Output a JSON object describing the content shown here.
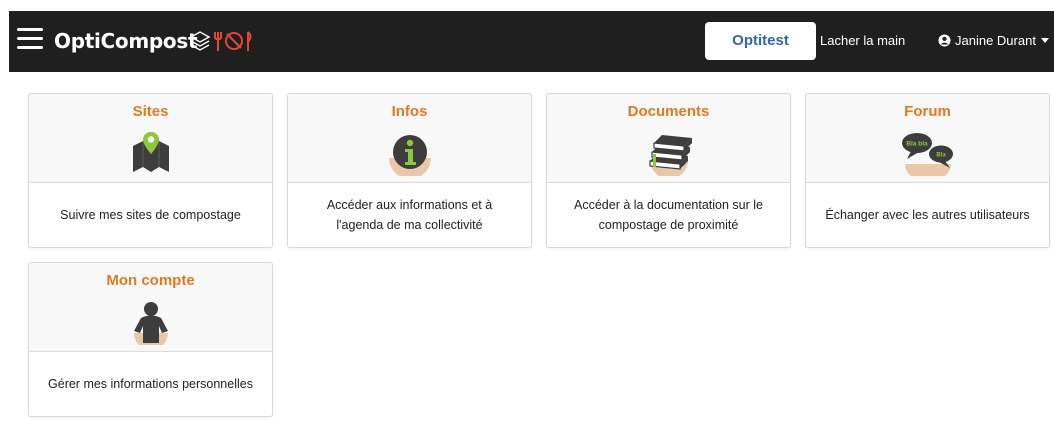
{
  "header": {
    "brand": "OptiCompost",
    "optitest_label": "Optitest",
    "lacher_label": "Lacher la main",
    "user_name": "Janine Durant"
  },
  "colors": {
    "navbar": "#1f1f1f",
    "accent_title": "#e07a22",
    "optitest_text": "#2f6aa8"
  },
  "cards": [
    {
      "title": "Sites",
      "icon": "map-pin-icon",
      "description": "Suivre mes sites de compostage"
    },
    {
      "title": "Infos",
      "icon": "info-icon",
      "description": "Accéder aux informations et à l'agenda de ma collectivité"
    },
    {
      "title": "Documents",
      "icon": "book-stack-icon",
      "description": "Accéder à la documentation sur le compostage de proximité"
    },
    {
      "title": "Forum",
      "icon": "chat-bubbles-icon",
      "bubble_text_1": "Bla bla",
      "bubble_text_2": "Bla",
      "description": "Échanger avec les autres utilisateurs"
    },
    {
      "title": "Mon compte",
      "icon": "person-icon",
      "description": "Gérer mes informations personnelles"
    }
  ]
}
